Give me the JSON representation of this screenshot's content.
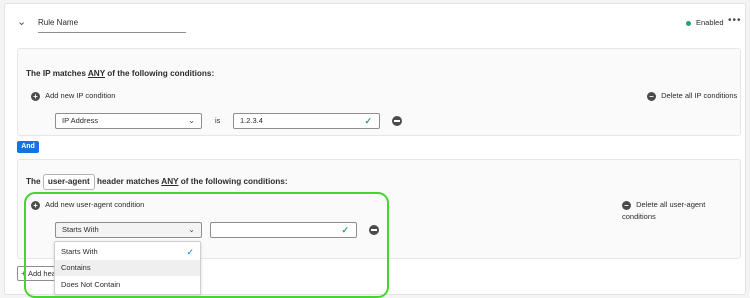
{
  "rule": {
    "name_value": "Rule Name",
    "status_label": "Enabled",
    "status_color": "#2d9d78",
    "more_icon": "ellipsis-icon"
  },
  "ip_section": {
    "heading_prefix": "The IP matches ",
    "heading_quantifier": "ANY",
    "heading_suffix": " of the following conditions:",
    "add_label": "Add new IP condition",
    "delete_all_label": "Delete all IP conditions",
    "condition": {
      "field_value": "IP Address",
      "operator_label": "is",
      "value": "1.2.3.4"
    }
  },
  "and_button_label": "And",
  "ua_section": {
    "heading_prefix": "The ",
    "heading_token": "user-agent",
    "heading_middle": " header matches ",
    "heading_quantifier": "ANY",
    "heading_suffix": " of the following conditions:",
    "add_label": "Add new user-agent condition",
    "delete_all_label": "Delete all user-agent conditions",
    "condition": {
      "operator_value": "Starts With",
      "value": ""
    },
    "dropdown_options": [
      "Starts With",
      "Contains",
      "Does Not Contain"
    ]
  },
  "add_header_label": "Add header condition",
  "colors": {
    "accent": "#1473e6",
    "highlight": "#44d62c",
    "success": "#2d9d78"
  }
}
